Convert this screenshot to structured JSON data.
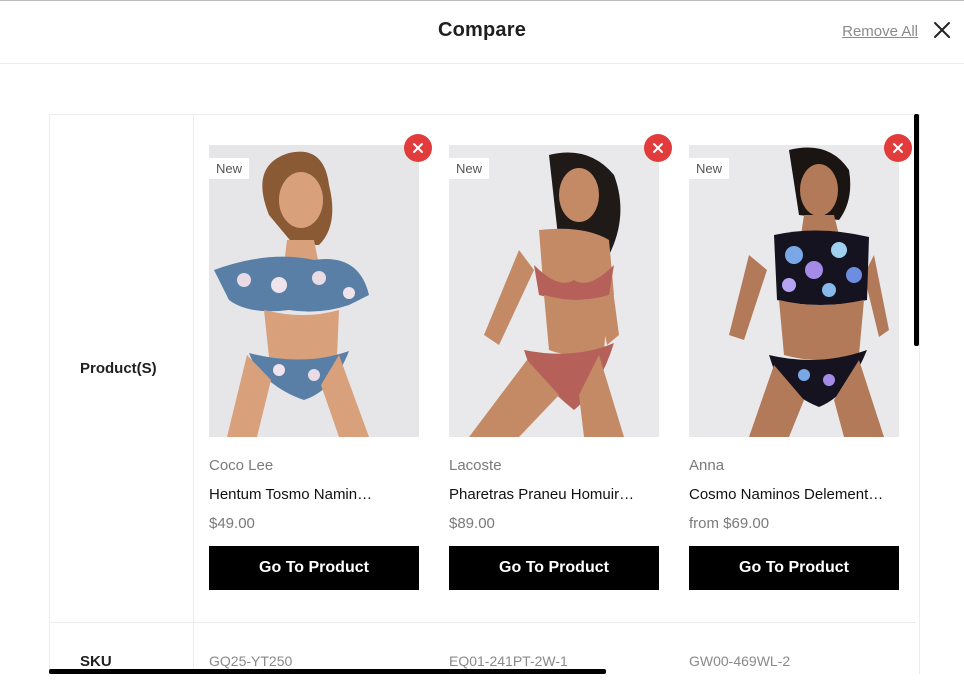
{
  "header": {
    "title": "Compare",
    "remove_all": "Remove All"
  },
  "rows": {
    "products_label": "Product(S)",
    "sku_label": "SKU"
  },
  "products": [
    {
      "badge": "New",
      "brand": "Coco Lee",
      "name": "Hentum Tosmo Namin…",
      "price": "$49.00",
      "button": "Go To Product",
      "sku": "GQ25-YT250"
    },
    {
      "badge": "New",
      "brand": "Lacoste",
      "name": "Pharetras Praneu Homuir…",
      "price": "$89.00",
      "button": "Go To Product",
      "sku": "EQ01-241PT-2W-1"
    },
    {
      "badge": "New",
      "brand": "Anna",
      "name": "Cosmo Naminos Delement…",
      "price": "from $69.00",
      "button": "Go To Product",
      "sku": "GW00-469WL-2"
    }
  ],
  "colors": {
    "remove_badge": "#e23b3b",
    "button_bg": "#000000"
  }
}
